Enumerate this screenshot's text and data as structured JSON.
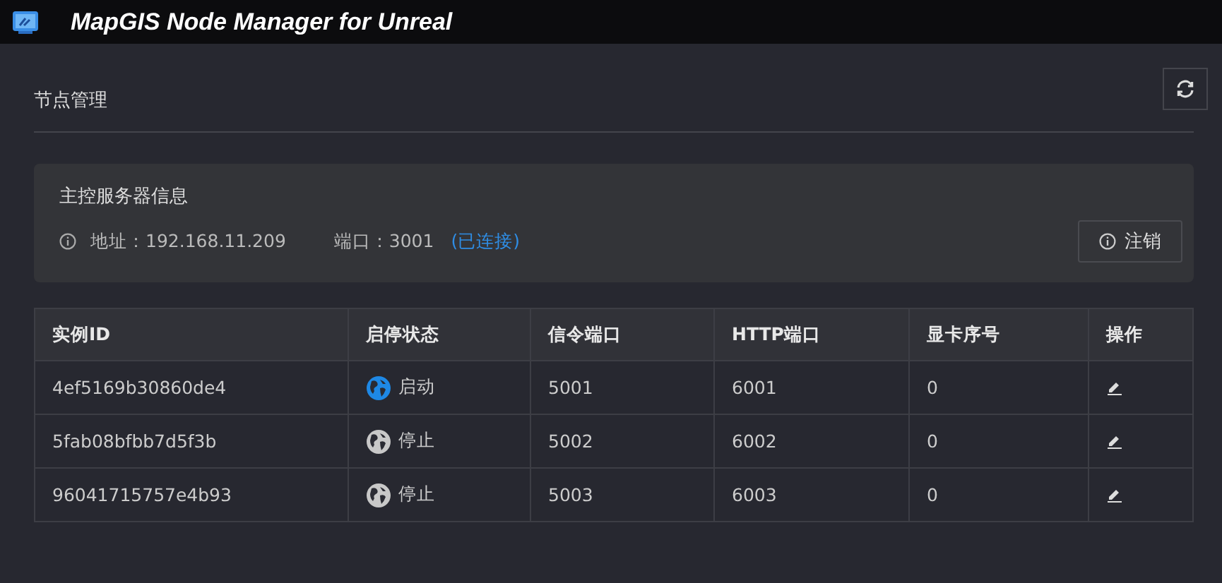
{
  "window": {
    "title": "MapGIS Node Manager for Unreal"
  },
  "page": {
    "title": "节点管理"
  },
  "server": {
    "title": "主控服务器信息",
    "address_label": "地址：",
    "address": "192.168.11.209",
    "port_label": "端口：",
    "port": "3001",
    "connection": "(已连接)",
    "logout_button": "注销"
  },
  "table": {
    "columns": [
      "实例ID",
      "启停状态",
      "信令端口",
      "HTTP端口",
      "显卡序号",
      "操作"
    ],
    "rows": [
      {
        "id": "4ef5169b30860de4",
        "running": true,
        "status": "启动",
        "signal_port": "5001",
        "http_port": "6001",
        "gpu": "0"
      },
      {
        "id": "5fab08bfbb7d5f3b",
        "running": false,
        "status": "停止",
        "signal_port": "5002",
        "http_port": "6002",
        "gpu": "0"
      },
      {
        "id": "96041715757e4b93",
        "running": false,
        "status": "停止",
        "signal_port": "5003",
        "http_port": "6003",
        "gpu": "0"
      }
    ]
  }
}
